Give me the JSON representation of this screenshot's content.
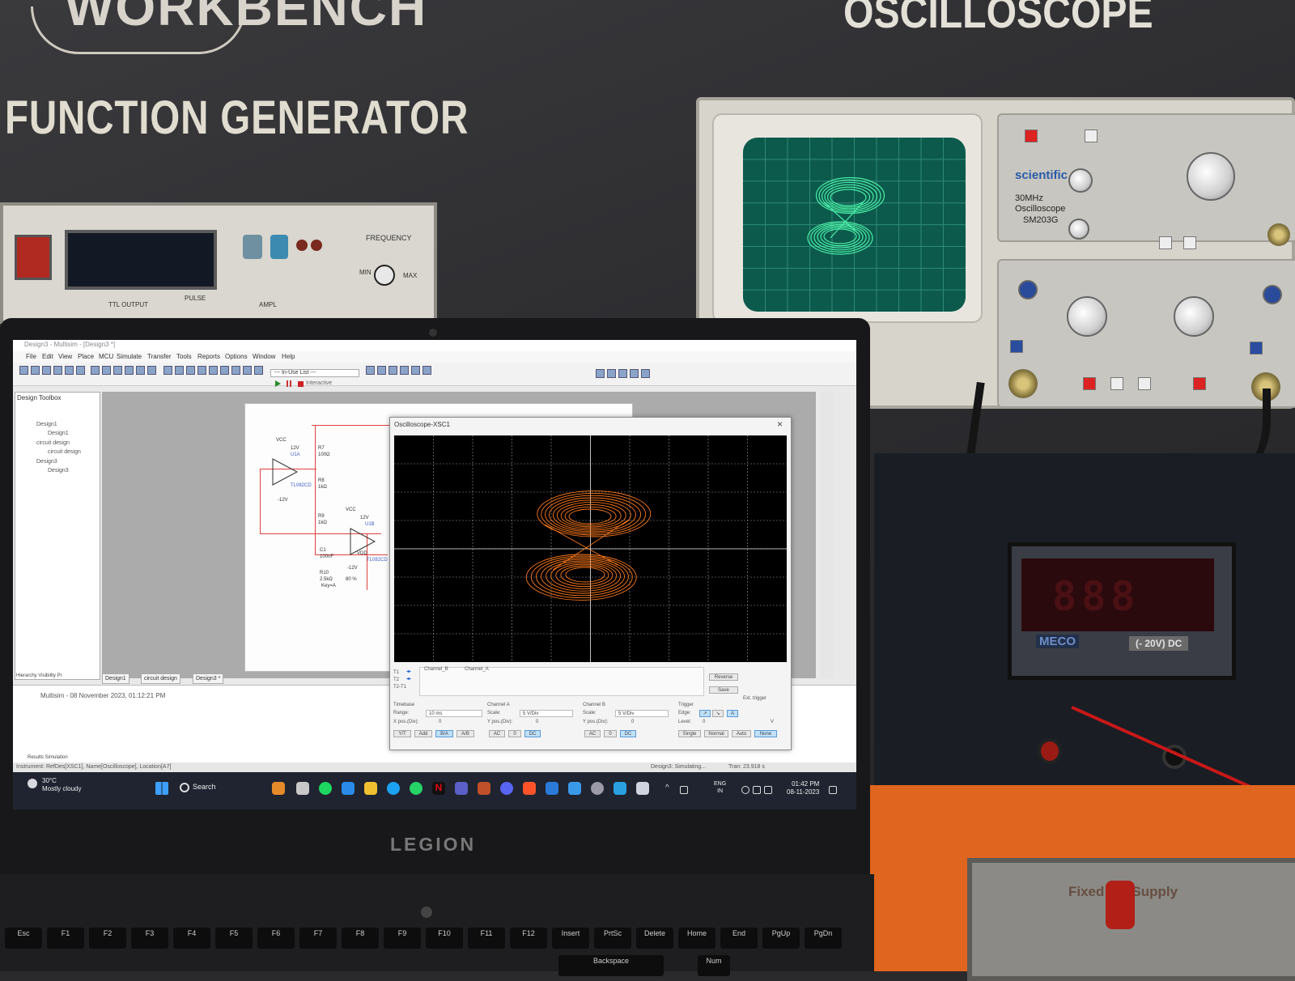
{
  "wall": {
    "logo_text": "WORKBENCH",
    "function_generator_title": "FUNCTION GENERATOR",
    "oscilloscope_title": "OSCILLOSCOPE"
  },
  "function_generator": {
    "frequency_label": "FREQUENCY",
    "min_label": "MIN",
    "max_label": "MAX",
    "ttl_output_label": "TTL OUTPUT",
    "pulse_label": "PULSE",
    "ampl_label": "AMPL"
  },
  "hardware_oscilloscope": {
    "brand": "scientific",
    "model_line1": "30MHz",
    "model_line2": "Oscilloscope",
    "model_line3": "SM203G"
  },
  "meter": {
    "brand": "MECO",
    "range_label": "(- 20V) DC",
    "digits": "888"
  },
  "dc_supply": {
    "label": "Fixed DC Supply"
  },
  "laptop": {
    "brand": "LEGION"
  },
  "app": {
    "title": "Design3 - Multisim - [Design3 *]",
    "menu": [
      "File",
      "Edit",
      "View",
      "Place",
      "MCU",
      "Simulate",
      "Transfer",
      "Tools",
      "Reports",
      "Options",
      "Window",
      "Help"
    ],
    "inuse_list": "--- In-Use List ---",
    "interactive_label": "Interactive",
    "toolbox_title": "Design Toolbox",
    "tree": [
      "Design1",
      "Design1",
      "circuit design",
      "circuit design",
      "Design3",
      "Design3"
    ],
    "toolbox_tabs": "Hierarchy  Visibility  Pr",
    "sheet_tabs": [
      "Design1",
      "circuit design",
      "Design3 *"
    ],
    "log_line": "Multisim  -  08 November 2023, 01:12:21 PM",
    "results_tabs": "Results  Simulation",
    "status_left": "Instrument: RefDes[XSC1], Name[Oscilloscope], Location[A7]",
    "status_mid": "Design3: Simulating...",
    "status_right": "Tran: 23.918 s"
  },
  "schematic": {
    "vcc1": "VCC",
    "v12a": "12V",
    "u1a": "U1A",
    "u1label": "TL082CD",
    "r7": "R7",
    "r7v": "100Ω",
    "r8": "R8",
    "r8v": "1kΩ",
    "m12a": "-12V",
    "r9": "R9",
    "r9v": "1kΩ",
    "vcc2": "VCC",
    "v12b": "12V",
    "u1b": "U1B",
    "c1": "C1",
    "c1v": "100nF",
    "r10": "R10",
    "r10v": "2.5kΩ",
    "r10pct": "80 %",
    "key": "Key=A",
    "vdd": "VDD",
    "m12b": "-12V",
    "u2label": "TL082CD"
  },
  "xsc": {
    "title": "Oscilloscope-XSC1",
    "t1": "T1",
    "t2": "T2",
    "t2t1": "T2-T1",
    "channel_b": "Channel_B",
    "channel_a": "Channel_A",
    "reverse": "Reverse",
    "save": "Save",
    "ext_trigger": "Ext. trigger",
    "timebase_label": "Timebase",
    "range_label": "Range:",
    "range_value": "10 ms",
    "xpos_label": "X pos.(Div):",
    "xpos_value": "0",
    "yt": "Y/T",
    "add": "Add",
    "ba": "B/A",
    "ab": "A/B",
    "cha_label": "Channel A",
    "cha_scale_label": "Scale:",
    "cha_scale": "5 V/Div",
    "cha_ypos_label": "Y pos.(Div):",
    "cha_ypos": "0",
    "chb_label": "Channel B",
    "chb_scale_label": "Scale:",
    "chb_scale": "5 V/Div",
    "chb_ypos_label": "Y pos.(Div):",
    "chb_ypos": "0",
    "ac": "AC",
    "zero": "0",
    "dc": "DC",
    "trigger_label": "Trigger",
    "edge_label": "Edge:",
    "level_label": "Level:",
    "level_value": "0",
    "level_unit": "V",
    "single": "Single",
    "normal": "Normal",
    "auto": "Auto",
    "none": "None",
    "trace_color": "#ff7a1a"
  },
  "taskbar": {
    "temp": "30°C",
    "weather": "Mostly cloudy",
    "search": "Search",
    "lang1": "ENG",
    "lang2": "IN",
    "time": "01:42 PM",
    "date": "08-11-2023"
  },
  "keyboard": {
    "keys": [
      "Esc",
      "F1",
      "F2",
      "F3",
      "F4",
      "F5",
      "F6",
      "F7",
      "F8",
      "F9",
      "F10",
      "F11",
      "F12",
      "Insert",
      "PrtSc",
      "Delete",
      "Home",
      "End",
      "PgUp",
      "PgDn"
    ],
    "backspace": "Backspace",
    "num": "Num"
  }
}
